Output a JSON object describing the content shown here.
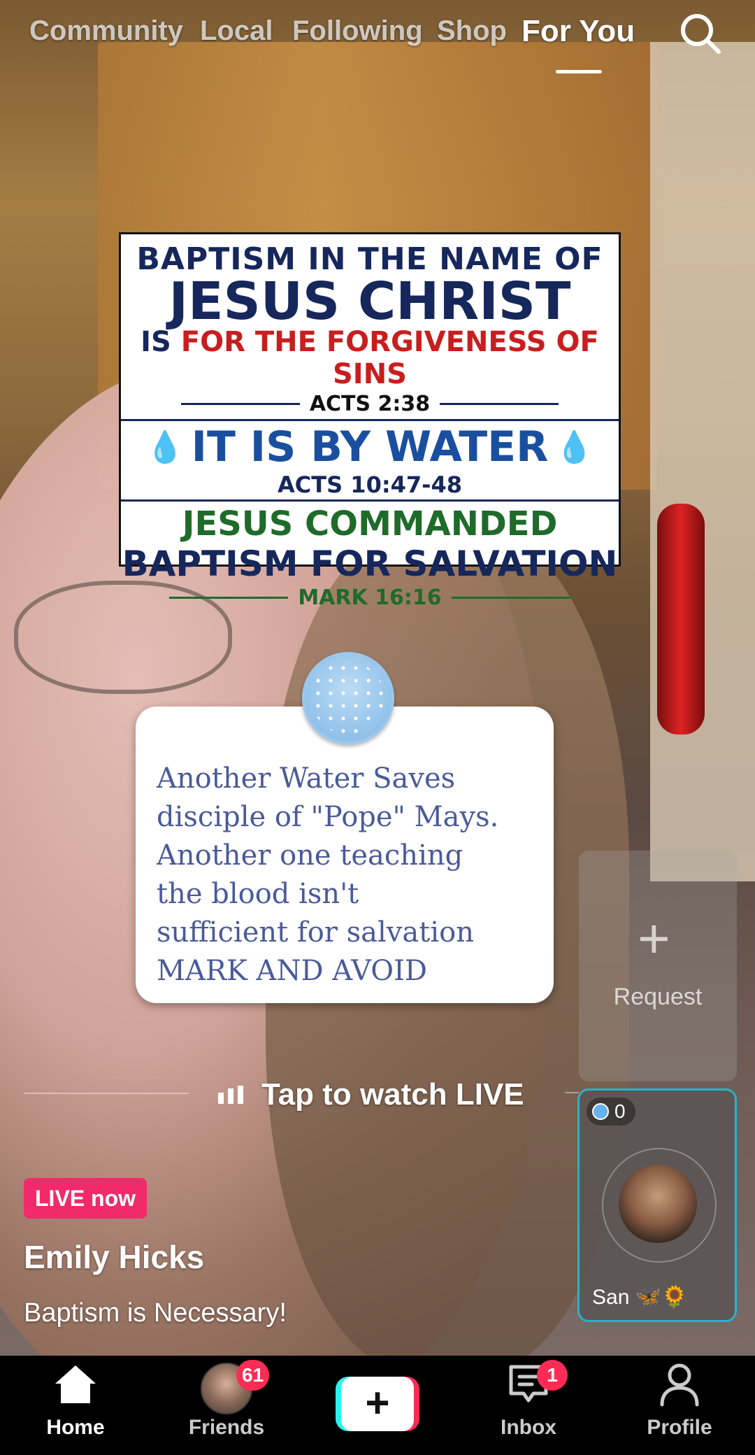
{
  "top_nav": {
    "tabs": [
      {
        "label": "Community"
      },
      {
        "label": "Local"
      },
      {
        "label": "Following"
      },
      {
        "label": "Shop"
      },
      {
        "label": "For You"
      }
    ],
    "active_tab": "For You",
    "search_icon": "search-icon"
  },
  "sign": {
    "line1": "BAPTISM IN THE NAME OF",
    "line2": "JESUS CHRIST",
    "line3_prefix": "IS ",
    "line3_red": "FOR THE FORGIVENESS OF SINS",
    "ref1": "ACTS 2:38",
    "line4": "IT IS BY WATER",
    "ref2": "ACTS 10:47-48",
    "line5": "JESUS COMMANDED",
    "line6": "BAPTISM FOR SALVATION",
    "ref3": "MARK 16:16"
  },
  "comment_card": {
    "text": "Another Water Saves\ndisciple of \"Pope\" Mays.\nAnother one teaching\nthe blood isn't\nsufficient for salvation\nMARK AND AVOID"
  },
  "request": {
    "label": "Request",
    "icon": "plus-icon"
  },
  "live_bar": {
    "label": "Tap to watch LIVE"
  },
  "guest": {
    "count": "0",
    "name": "San 🦋🌻"
  },
  "stream": {
    "badge": "LIVE now",
    "username": "Emily Hicks",
    "caption": "Baptism is Necessary!"
  },
  "bottom_nav": {
    "items": [
      {
        "label": "Home",
        "icon": "home-icon"
      },
      {
        "label": "Friends",
        "icon": "friends-avatar",
        "badge": "61"
      },
      {
        "label": "",
        "icon": "create-plus-icon"
      },
      {
        "label": "Inbox",
        "icon": "inbox-icon",
        "badge": "1"
      },
      {
        "label": "Profile",
        "icon": "profile-icon"
      }
    ]
  },
  "colors": {
    "live_pink": "#f02a6b",
    "badge_red": "#fe2c55",
    "guest_border": "#27b3c7",
    "card_text": "#4a5a9a"
  }
}
